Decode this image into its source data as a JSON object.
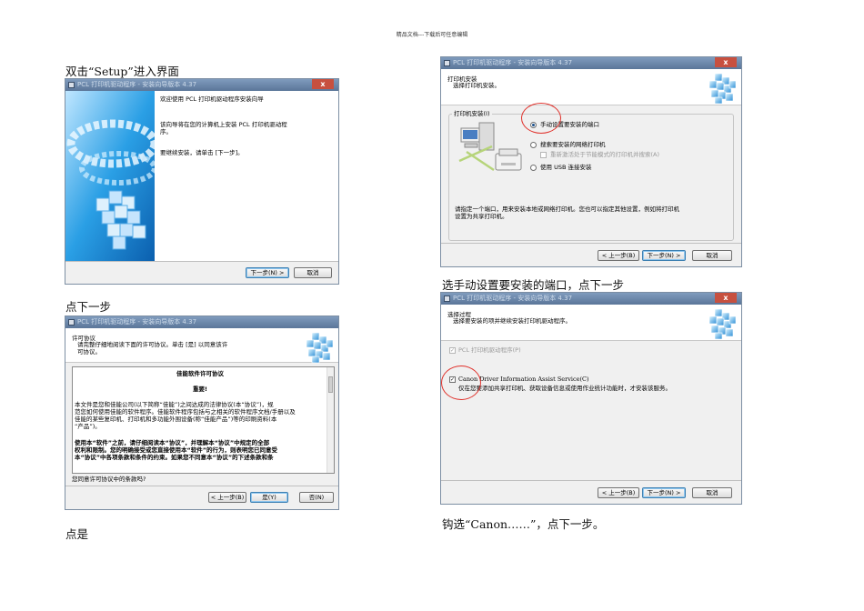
{
  "page_header": "精品文档---下载后可任意编辑",
  "captions": {
    "step1": "双击“Setup”进入界面",
    "step2": "点下一步",
    "step3": "点是",
    "step4": "选手动设置要安装的端口，点下一步",
    "step5": "钩选“Canon……”，点下一步。"
  },
  "dialog_title": "PCL 打印机驱动程序 - 安装向导版本 4.37",
  "close_glyph": "x",
  "wizard_welcome": {
    "line1": "欢迎使用 PCL 打印机驱动程序安装向导",
    "line2": "该向导将在您的计算机上安装 PCL 打印机驱动程",
    "line3": "序。",
    "line4": "要继续安装，请单击 [下一步]。",
    "next_button": "下一步(N) >",
    "cancel_button": "取消"
  },
  "license": {
    "header_title": "许可协议",
    "header_sub_line1": "请完整仔细地阅读下面的许可协议。单击 [是] 以同意该许",
    "header_sub_line2": "可协议。",
    "doc_title": "佳能软件许可协议",
    "important": "重要!",
    "para1": [
      "本文件是您和佳能公司(以下简称“佳能”)之间达成的法律协议(本“协议”)，规",
      "范您如何使用佳能的软件程序。佳能软件程序包括与之相关的软件程序文档/手册以及",
      "佳能的某些复印机、打印机和多功能外围设备(称“佳能产品”)等的印刷资料(本",
      "“产品”)。"
    ],
    "para2": [
      "使用本“软件”之前，请仔细阅读本“协议”，并理解本“协议”中规定的全部",
      "权利和限制。您的明确接受或您直接使用本“软件”的行为，则表明您已同意受",
      "本“协议”中各项条款和条件的约束。如果您不同意本“协议”的下述条款和条"
    ],
    "question": "您同意许可协议中的条款吗?",
    "back_button": "< 上一步(B)",
    "yes_button": "是(Y)",
    "no_button": "否(N)"
  },
  "printer_setup": {
    "header_title": "打印机安装",
    "header_sub": "选择打印机安装。",
    "group_label": "打印机安装(I)",
    "opt_manual": "手动设置要安装的端口",
    "opt_network": "搜索要安装的网络打印机",
    "opt_network_sub": "重新激活处于节能模式的打印机并搜索(A)",
    "opt_usb": "使用 USB 连接安装",
    "help_line1": "请指定一个端口，用来安装本地或网络打印机。您也可以指定其他设置，例如将打印机",
    "help_line2": "设置为共享打印机。",
    "back_button": "< 上一步(B)",
    "next_button": "下一步(N) >",
    "cancel_button": "取消"
  },
  "process_select": {
    "header_title": "选择过程",
    "header_sub": "选择要安装的项并继续安装打印机驱动程序。",
    "item1": "PCL 打印机驱动程序(P)",
    "item2": "Canon Driver Information Assist Service(C)",
    "item2_desc": "仅在您要添加共享打印机、获取设备信息或使用作业统计功能时，才安装该服务。",
    "back_button": "< 上一步(B)",
    "next_button": "下一步(N) >",
    "cancel_button": "取消",
    "check_glyph": "✓"
  }
}
